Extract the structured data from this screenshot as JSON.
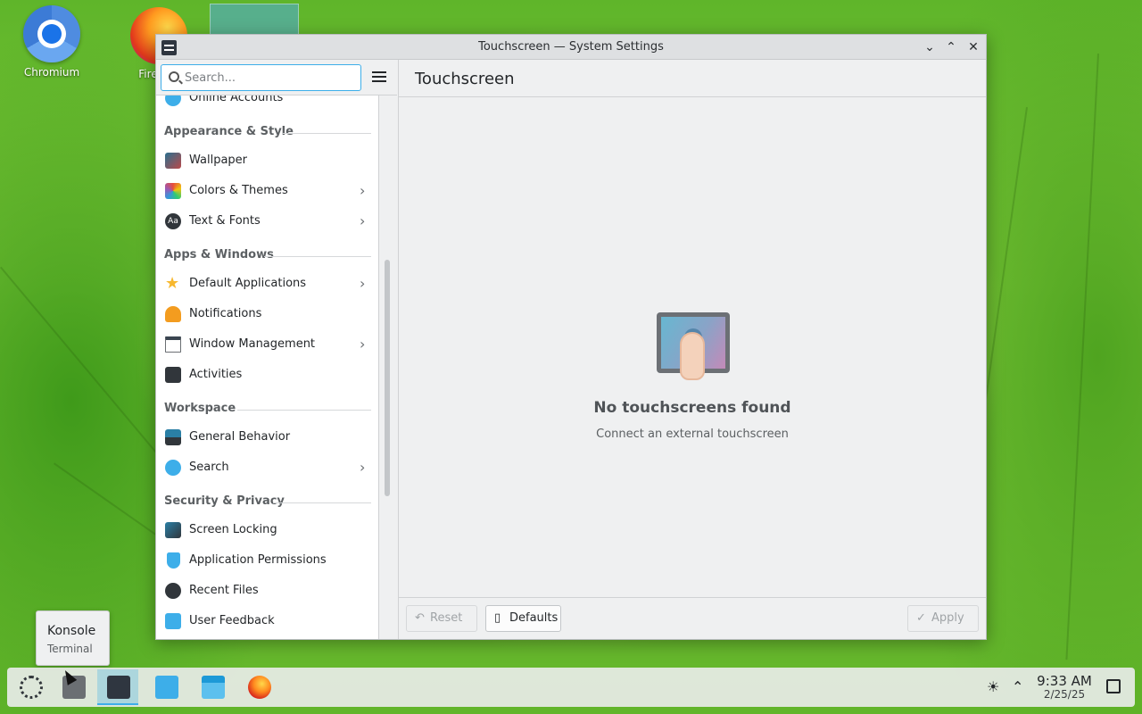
{
  "desktop": {
    "icons": [
      {
        "label": "Chromium",
        "icon": "chromium-icon"
      },
      {
        "label": "Fire",
        "icon": "firefox-icon"
      }
    ]
  },
  "window": {
    "title": "Touchscreen — System Settings",
    "search_placeholder": "Search...",
    "sidebar": {
      "partial_item": {
        "label": "Online Accounts",
        "icon": "online-accounts-icon"
      },
      "sections": [
        {
          "title": "Appearance & Style",
          "items": [
            {
              "label": "Wallpaper",
              "icon": "wallpaper-icon",
              "submenu": false
            },
            {
              "label": "Colors & Themes",
              "icon": "colors-themes-icon",
              "submenu": true
            },
            {
              "label": "Text & Fonts",
              "icon": "text-fonts-icon",
              "submenu": true
            }
          ]
        },
        {
          "title": "Apps & Windows",
          "items": [
            {
              "label": "Default Applications",
              "icon": "star-icon",
              "submenu": true
            },
            {
              "label": "Notifications",
              "icon": "bell-icon",
              "submenu": false
            },
            {
              "label": "Window Management",
              "icon": "window-icon",
              "submenu": true
            },
            {
              "label": "Activities",
              "icon": "activities-icon",
              "submenu": false
            }
          ]
        },
        {
          "title": "Workspace",
          "items": [
            {
              "label": "General Behavior",
              "icon": "general-behavior-icon",
              "submenu": false
            },
            {
              "label": "Search",
              "icon": "search-icon",
              "submenu": true
            }
          ]
        },
        {
          "title": "Security & Privacy",
          "items": [
            {
              "label": "Screen Locking",
              "icon": "screen-lock-icon",
              "submenu": false
            },
            {
              "label": "Application Permissions",
              "icon": "shield-icon",
              "submenu": false
            },
            {
              "label": "Recent Files",
              "icon": "clock-icon",
              "submenu": false
            },
            {
              "label": "User Feedback",
              "icon": "feedback-icon",
              "submenu": false
            }
          ]
        }
      ]
    },
    "content": {
      "heading": "Touchscreen",
      "empty_title": "No touchscreens found",
      "empty_subtitle": "Connect an external touchscreen"
    },
    "footer": {
      "reset_label": "Reset",
      "defaults_label": "Defaults",
      "apply_label": "Apply"
    }
  },
  "tooltip": {
    "title": "Konsole",
    "subtitle": "Terminal"
  },
  "taskbar": {
    "time": "9:33 AM",
    "date": "2/25/25",
    "items": [
      "app-launcher-icon",
      "konsole-icon",
      "system-settings-icon",
      "discover-icon",
      "dolphin-icon",
      "firefox-icon"
    ]
  }
}
